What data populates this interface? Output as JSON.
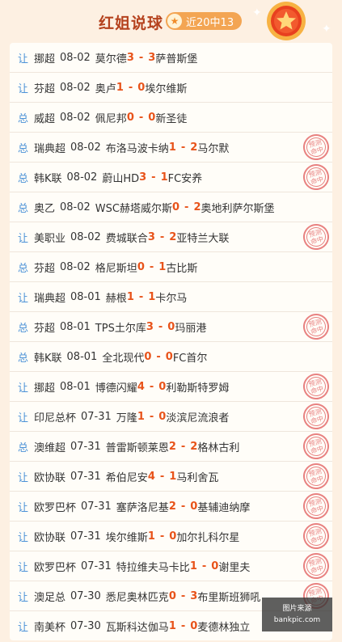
{
  "header": {
    "title": "红姐说球",
    "record_icon": "star-icon",
    "record": "近20中13"
  },
  "colors": {
    "accent": "#e8531a",
    "type_label": "#4c92d7",
    "stamp": "#e56d6d",
    "badge": "#f3a553"
  },
  "stamp_text": [
    "预测",
    "命中"
  ],
  "matches": [
    {
      "type": "让",
      "league": "挪超",
      "date": "08-02",
      "home": "莫尔德",
      "hs": "3",
      "as": "3",
      "away": "萨普斯堡",
      "hit": false
    },
    {
      "type": "让",
      "league": "芬超",
      "date": "08-02",
      "home": "奥卢",
      "hs": "1",
      "as": "0",
      "away": "埃尔维斯",
      "hit": false
    },
    {
      "type": "总",
      "league": "威超",
      "date": "08-02",
      "home": "佩尼邦",
      "hs": "0",
      "as": "0",
      "away": "新圣徒",
      "hit": false
    },
    {
      "type": "总",
      "league": "瑞典超",
      "date": "08-02",
      "home": "布洛马波卡纳",
      "hs": "1",
      "as": "2",
      "away": "马尔默",
      "hit": true
    },
    {
      "type": "总",
      "league": "韩K联",
      "date": "08-02",
      "home": "蔚山HD",
      "hs": "3",
      "as": "1",
      "away": "FC安养",
      "hit": true
    },
    {
      "type": "总",
      "league": "奥乙",
      "date": "08-02",
      "home": "WSC赫塔威尔斯",
      "hs": "0",
      "as": "2",
      "away": "奥地利萨尔斯堡",
      "hit": false
    },
    {
      "type": "让",
      "league": "美职业",
      "date": "08-02",
      "home": "费城联合",
      "hs": "3",
      "as": "2",
      "away": "亚特兰大联",
      "hit": true
    },
    {
      "type": "总",
      "league": "芬超",
      "date": "08-02",
      "home": "格尼斯坦",
      "hs": "0",
      "as": "1",
      "away": "古比斯",
      "hit": false
    },
    {
      "type": "让",
      "league": "瑞典超",
      "date": "08-01",
      "home": "赫根",
      "hs": "1",
      "as": "1",
      "away": "卡尔马",
      "hit": false
    },
    {
      "type": "总",
      "league": "芬超",
      "date": "08-01",
      "home": "TPS土尔库",
      "hs": "3",
      "as": "0",
      "away": "玛丽港",
      "hit": true
    },
    {
      "type": "总",
      "league": "韩K联",
      "date": "08-01",
      "home": "全北现代",
      "hs": "0",
      "as": "0",
      "away": "FC首尔",
      "hit": false
    },
    {
      "type": "让",
      "league": "挪超",
      "date": "08-01",
      "home": "博德闪耀",
      "hs": "4",
      "as": "0",
      "away": "利勒斯特罗姆",
      "hit": true
    },
    {
      "type": "让",
      "league": "印尼总杯",
      "date": "07-31",
      "home": "万隆",
      "hs": "1",
      "as": "0",
      "away": "淡滨尼流浪者",
      "hit": true
    },
    {
      "type": "总",
      "league": "澳维超",
      "date": "07-31",
      "home": "普雷斯顿莱恩",
      "hs": "2",
      "as": "2",
      "away": "格林古利",
      "hit": true
    },
    {
      "type": "让",
      "league": "欧协联",
      "date": "07-31",
      "home": "希伯尼安",
      "hs": "4",
      "as": "1",
      "away": "马利舍瓦",
      "hit": true
    },
    {
      "type": "让",
      "league": "欧罗巴杯",
      "date": "07-31",
      "home": "塞萨洛尼基",
      "hs": "2",
      "as": "0",
      "away": "基辅迪纳摩",
      "hit": true
    },
    {
      "type": "让",
      "league": "欧协联",
      "date": "07-31",
      "home": "埃尔维斯",
      "hs": "1",
      "as": "0",
      "away": "加尔扎科尔星",
      "hit": true
    },
    {
      "type": "让",
      "league": "欧罗巴杯",
      "date": "07-31",
      "home": "特拉维夫马卡比",
      "hs": "1",
      "as": "0",
      "away": "谢里夫",
      "hit": true
    },
    {
      "type": "让",
      "league": "澳足总",
      "date": "07-30",
      "home": "悉尼奥林匹克",
      "hs": "0",
      "as": "3",
      "away": "布里斯班狮吼",
      "hit": true
    },
    {
      "type": "让",
      "league": "南美杯",
      "date": "07-30",
      "home": "瓦斯科达伽马",
      "hs": "1",
      "as": "0",
      "away": "麦德林独立",
      "hit": false
    }
  ],
  "watermark": {
    "line1": "图片来源",
    "line2": "bankpic.com"
  }
}
